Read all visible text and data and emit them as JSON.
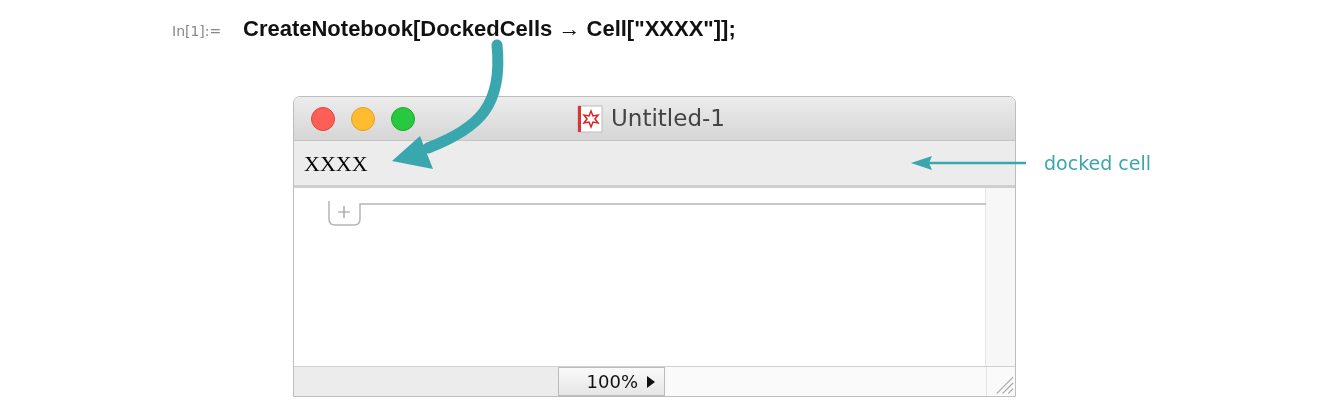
{
  "input": {
    "label": "In[1]:=",
    "code": "CreateNotebook[DockedCells → Cell[\"XXXX\"]];"
  },
  "window": {
    "title": "Untitled-1",
    "docked_cell": "XXXX",
    "zoom": "100%"
  },
  "annotation": {
    "label": "docked cell"
  }
}
